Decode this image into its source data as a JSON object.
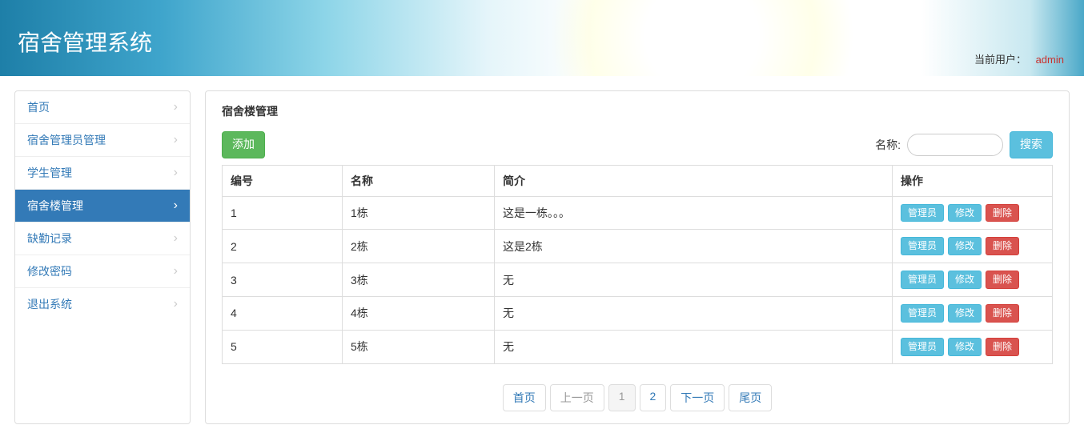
{
  "header": {
    "title": "宿舍管理系统",
    "user_label": "当前用户：",
    "user_name": "admin"
  },
  "sidebar": {
    "items": [
      {
        "label": "首页",
        "active": false
      },
      {
        "label": "宿舍管理员管理",
        "active": false
      },
      {
        "label": "学生管理",
        "active": false
      },
      {
        "label": "宿舍楼管理",
        "active": true
      },
      {
        "label": "缺勤记录",
        "active": false
      },
      {
        "label": "修改密码",
        "active": false
      },
      {
        "label": "退出系统",
        "active": false
      }
    ]
  },
  "main": {
    "page_title": "宿舍楼管理",
    "add_button": "添加",
    "search_label": "名称:",
    "search_button": "搜索",
    "search_value": "",
    "columns": [
      "编号",
      "名称",
      "简介",
      "操作"
    ],
    "rows": [
      {
        "id": "1",
        "name": "1栋",
        "desc": "这是一栋。。。"
      },
      {
        "id": "2",
        "name": "2栋",
        "desc": "这是2栋"
      },
      {
        "id": "3",
        "name": "3栋",
        "desc": "无"
      },
      {
        "id": "4",
        "name": "4栋",
        "desc": "无"
      },
      {
        "id": "5",
        "name": "5栋",
        "desc": "无"
      }
    ],
    "row_actions": {
      "manager": "管理员",
      "edit": "修改",
      "delete": "删除"
    },
    "pagination": {
      "first": "首页",
      "prev": "上一页",
      "next": "下一页",
      "last": "尾页",
      "pages": [
        "1",
        "2"
      ],
      "current": "1"
    }
  }
}
